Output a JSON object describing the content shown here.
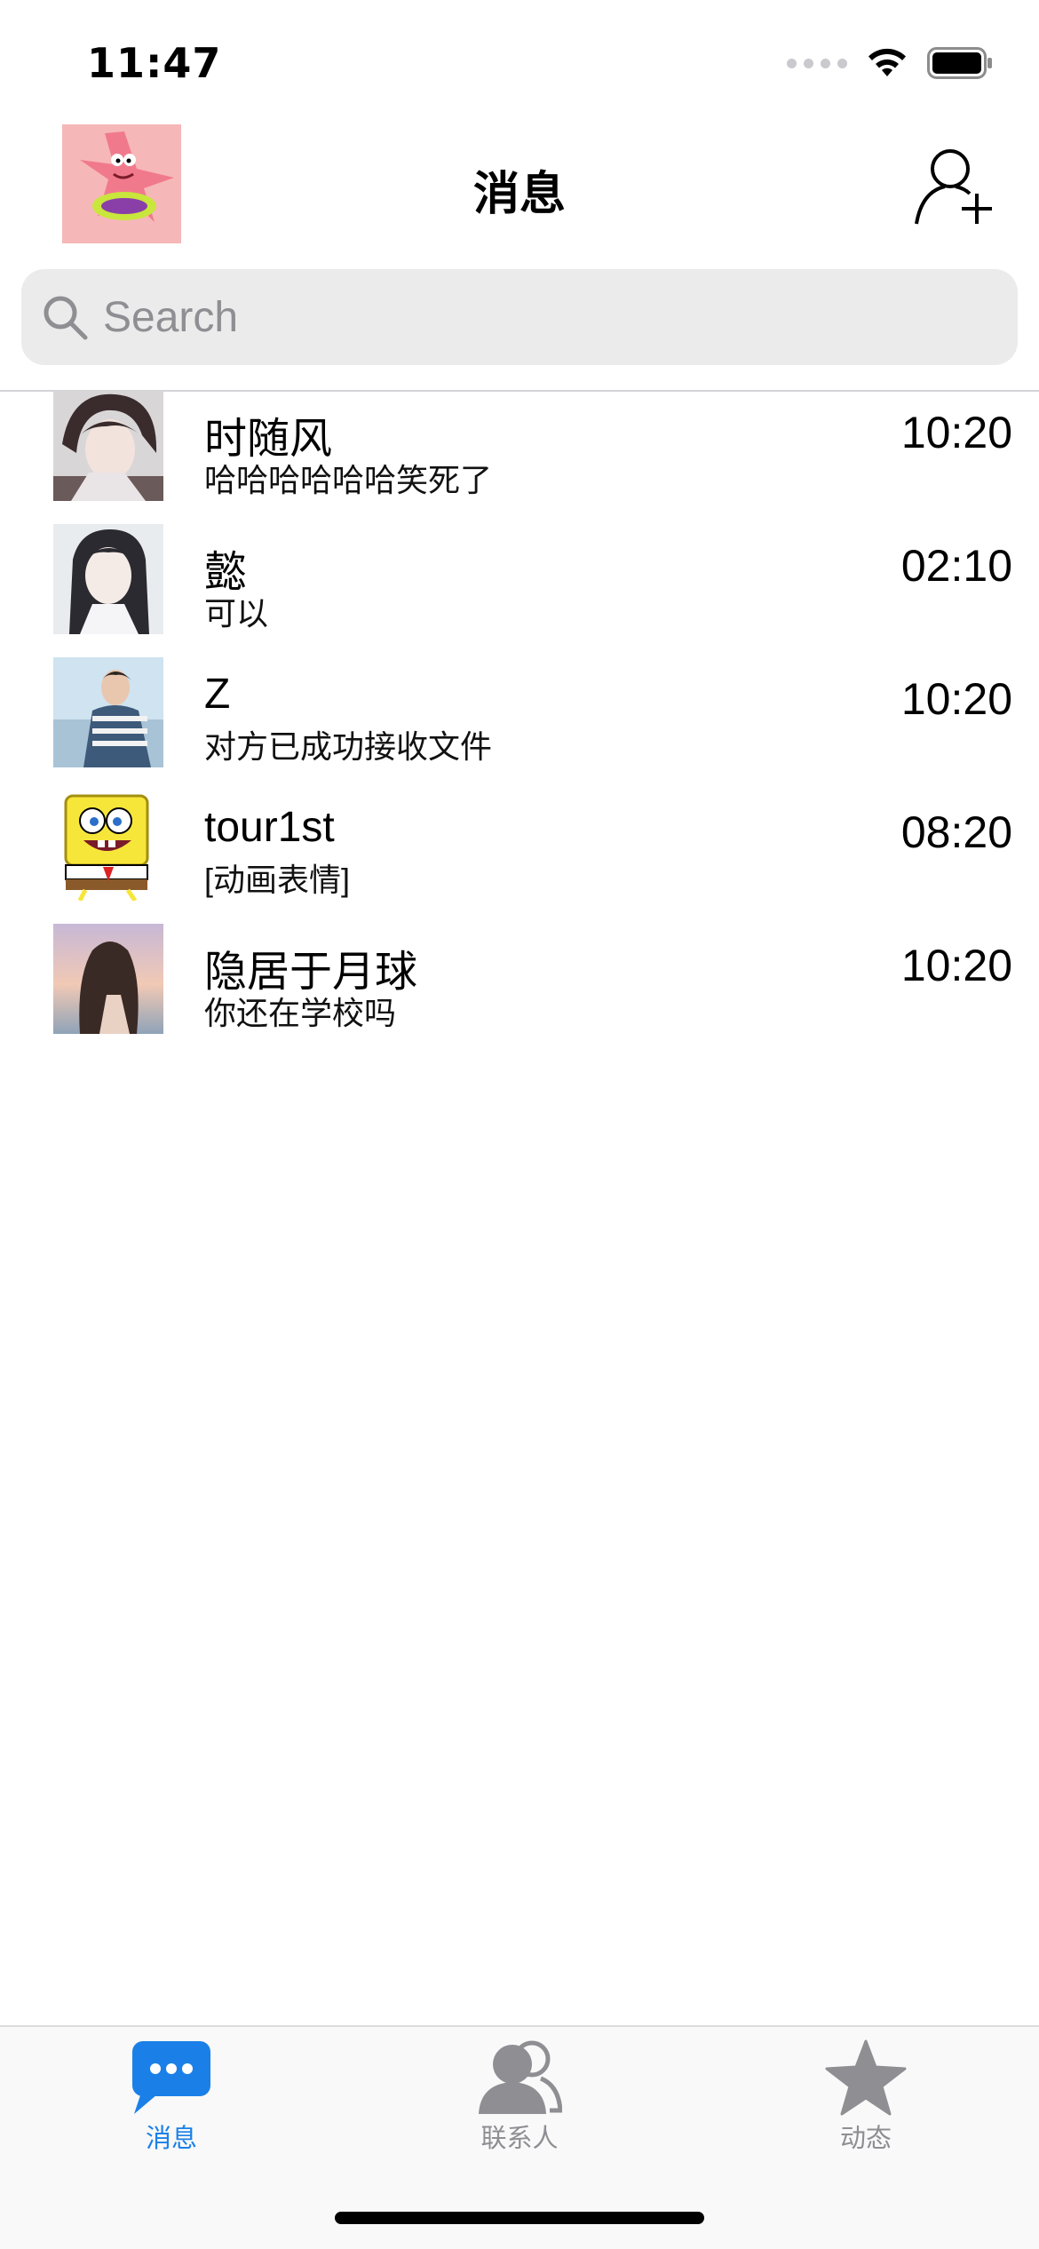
{
  "status_bar": {
    "time": "11:47"
  },
  "header": {
    "title": "消息"
  },
  "search": {
    "placeholder": "Search"
  },
  "conversations": [
    {
      "name": "时随风",
      "message": "哈哈哈哈哈哈笑死了",
      "time": "10:20"
    },
    {
      "name": "懿",
      "message": "可以",
      "time": "02:10"
    },
    {
      "name": "Z",
      "message": "对方已成功接收文件",
      "time": "10:20"
    },
    {
      "name": "tour1st",
      "message": "[动画表情]",
      "time": "08:20"
    },
    {
      "name": "隐居于月球",
      "message": "你还在学校吗",
      "time": "10:20"
    }
  ],
  "tabbar": {
    "tabs": [
      {
        "label": "消息",
        "icon": "chat-bubble-icon",
        "active": true
      },
      {
        "label": "联系人",
        "icon": "contacts-icon",
        "active": false
      },
      {
        "label": "动态",
        "icon": "star-icon",
        "active": false
      }
    ]
  },
  "colors": {
    "accent": "#1a80e8",
    "inactive": "#8e8e93",
    "search_bg": "#ebebeb"
  }
}
